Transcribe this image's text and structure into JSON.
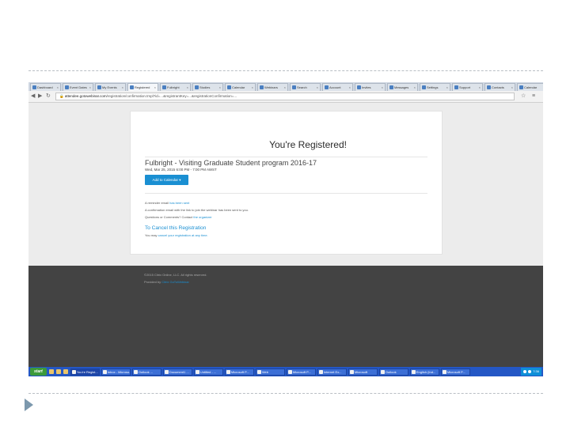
{
  "browser": {
    "tabs": [
      "Dashboard",
      "Event Dates",
      "My Events",
      "Registered",
      "Fulbright",
      "Studies",
      "Calendar",
      "Webinars",
      "Search",
      "Account",
      "Invites",
      "Messages",
      "Settings",
      "Support",
      "Contacts",
      "Calendar"
    ],
    "active_tab_index": 3,
    "url_host": "attendee.gotowebinar.com",
    "url_rest": "/registration/confirmation.tmpl?id=...&registrantKey=...&registrationConfirmation=..."
  },
  "confirmation": {
    "title": "You're Registered!",
    "webinar_title": "Fulbright - Visiting Graduate Student program 2016-17",
    "date_line": "Wed, Mar 25, 2015 6:00 PM - 7:00 PM AWST",
    "add_calendar_label": "Add to Calendar ▾",
    "line1_text": "A reminder email ",
    "line1_link": "has been sent",
    "line2_text": "A confirmation email with the link to join the webinar has been sent to you.",
    "line3_text": "Questions or Comments? Contact ",
    "line3_link": "the organizer",
    "cancel_heading": "To Cancel this Registration",
    "cancel_text": "You may ",
    "cancel_link": "cancel your registration at any time."
  },
  "footer": {
    "copyright": "©2015 Citrix Online, LLC. All rights reserved.",
    "prefix": "Provided by ",
    "link": "Citrix GoToWebinar"
  },
  "taskbar": {
    "start_label": "start",
    "tasks": [
      "You're Regist...",
      "Inbox - Microso...",
      "Outlook ...",
      "Document1 ...",
      "Untitled - ...",
      "Microsoft P...",
      "Web",
      "Microsoft P...",
      "Internet Ex...",
      "Microsoft",
      "Outlook",
      "English (Ind...",
      "Microsoft P..."
    ],
    "active_task_index": 0,
    "clock": "7:36"
  },
  "colors": {
    "accent": "#1a8fd2",
    "footer_bg": "#434343",
    "taskbar": "#2457c5"
  }
}
